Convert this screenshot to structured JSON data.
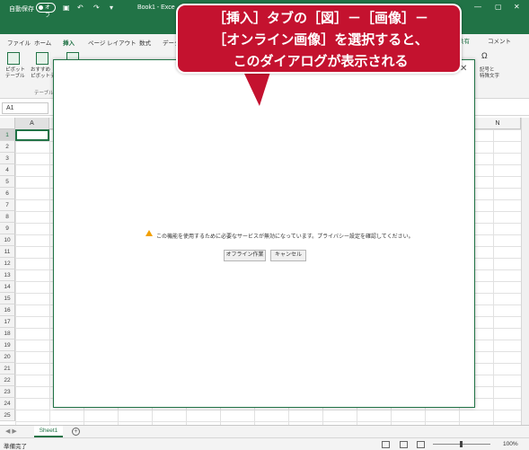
{
  "titlebar": {
    "autosave_label": "自動保存",
    "autosave_state": "オフ",
    "book_title": "Book1 - Exce"
  },
  "ribbon_tabs": [
    "ファイル",
    "ホーム",
    "挿入",
    "ページ レイアウト",
    "数式",
    "データ"
  ],
  "active_tab": "挿入",
  "share_label": "共有",
  "comment_label": "コメント",
  "ribbon": {
    "pivot_label_1": "ピボット",
    "pivot_label_2": "テーブル",
    "recommended_label_1": "おすすめ",
    "recommended_label_2": "ピボットテー",
    "group_label": "テーブル",
    "right_label_1": "記号と",
    "right_label_2": "特殊文字"
  },
  "namebox": "A1",
  "columns": {
    "a": "A",
    "n": "N"
  },
  "rows": [
    "1",
    "2",
    "3",
    "4",
    "5",
    "6",
    "7",
    "8",
    "9",
    "10",
    "11",
    "12",
    "13",
    "14",
    "15",
    "16",
    "17",
    "18",
    "19",
    "20",
    "21",
    "22",
    "23",
    "24",
    "25"
  ],
  "sheet_tab": "Sheet1",
  "status": {
    "ready": "準備完了",
    "zoom": "100%"
  },
  "dialog": {
    "message": "この機能を使用するために必要なサービスが無効になっています。プライバシー設定を確認してください。",
    "offline_button": "オフライン作業",
    "cancel_button": "キャンセル"
  },
  "callout": {
    "line1": "［挿入］タブの［図］－［画像］－",
    "line2": "［オンライン画像］を選択すると、",
    "line3": "このダイアログが表示される"
  }
}
